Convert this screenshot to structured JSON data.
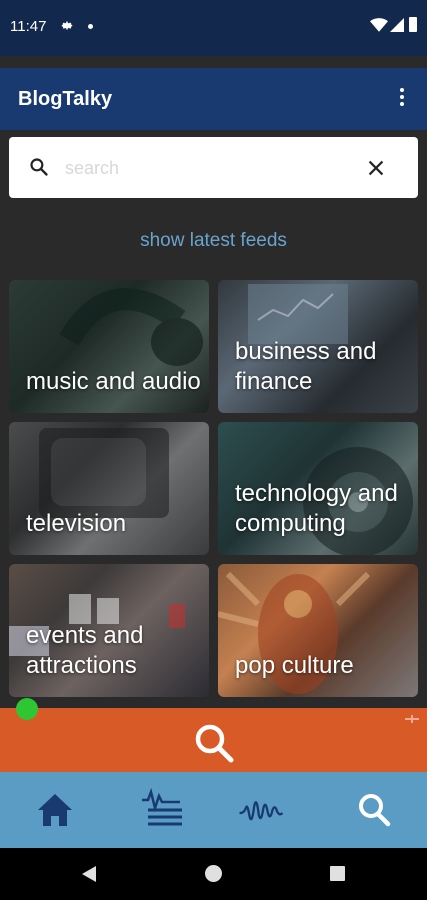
{
  "status_bar": {
    "time": "11:47"
  },
  "app_bar": {
    "title": "BlogTalky"
  },
  "search": {
    "placeholder": "search"
  },
  "latest_link": "show latest feeds",
  "categories": [
    {
      "label": "music and audio"
    },
    {
      "label": "business and finance"
    },
    {
      "label": "television"
    },
    {
      "label": "technology and computing"
    },
    {
      "label": "events and attractions"
    },
    {
      "label": "pop culture"
    }
  ],
  "bottom_nav": {
    "items": [
      "home-icon",
      "feed-list-icon",
      "audio-wave-icon",
      "search-icon"
    ]
  },
  "colors": {
    "status_bar": "#13284d",
    "app_bar": "#183a70",
    "background": "#2a2a2a",
    "accent_link": "#6aa3cc",
    "search_strip": "#d85a26",
    "bottom_nav": "#5a9cc4",
    "nav_icons": "#183a70",
    "indicator": "#2ec633"
  }
}
